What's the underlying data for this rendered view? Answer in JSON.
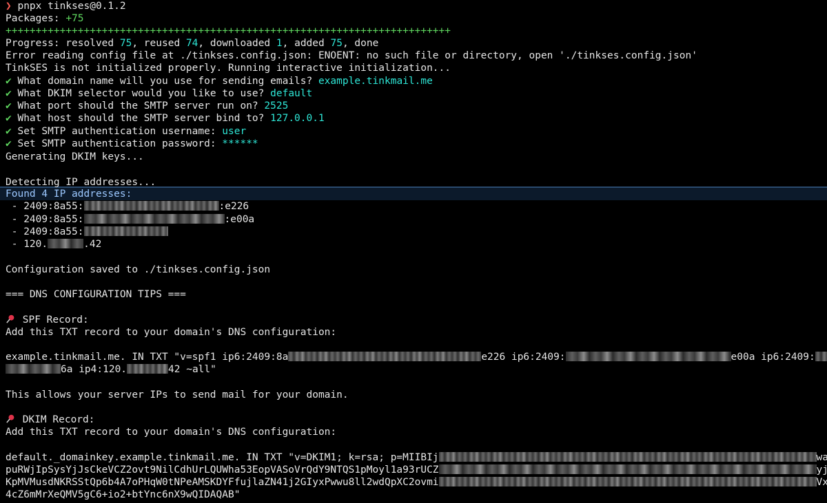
{
  "prompt": {
    "mark": "❯",
    "command": "pnpx tinkses@0.1.2"
  },
  "packages": {
    "label": "Packages: ",
    "value": "+75"
  },
  "progress_bar": "++++++++++++++++++++++++++++++++++++++++++++++++++++++++++++++++++++++++++",
  "progress": {
    "prefix": "Progress: resolved ",
    "resolved": "75",
    "reused_label": ", reused ",
    "reused": "74",
    "downloaded_label": ", downloaded ",
    "downloaded": "1",
    "added_label": ", added ",
    "added": "75",
    "suffix": ", done"
  },
  "error_line": "Error reading config file at ./tinkses.config.json: ENOENT: no such file or directory, open './tinkses.config.json'",
  "init_line": "TinkSES is not initialized properly. Running interactive initialization...",
  "questions": [
    {
      "check": "✔",
      "question": " What domain name will you use for sending emails? ",
      "answer": "example.tinkmail.me"
    },
    {
      "check": "✔",
      "question": " What DKIM selector would you like to use? ",
      "answer": "default"
    },
    {
      "check": "✔",
      "question": " What port should the SMTP server run on? ",
      "answer": "2525"
    },
    {
      "check": "✔",
      "question": " What host should the SMTP server bind to? ",
      "answer": "127.0.0.1"
    },
    {
      "check": "✔",
      "question": " Set SMTP authentication username: ",
      "answer": "user"
    },
    {
      "check": "✔",
      "question": " Set SMTP authentication password: ",
      "answer": "******"
    }
  ],
  "generating": "Generating DKIM keys...",
  "detecting": "Detecting IP addresses...",
  "found": "Found 4 IP addresses:",
  "ips": [
    {
      "prefix": " - 2409:8a55:",
      "suffix": ":e226"
    },
    {
      "prefix": " - 2409:8a55:",
      "suffix": ":e00a"
    },
    {
      "prefix": " - 2409:8a55:",
      "suffix": ""
    },
    {
      "prefix": " - 120.",
      "suffix": ".42"
    }
  ],
  "saved": "Configuration saved to ./tinkses.config.json",
  "dns_header": "=== DNS CONFIGURATION TIPS ===",
  "spf": {
    "title": " SPF Record:",
    "instruction": "Add this TXT record to your domain's DNS configuration:",
    "line1_a": "example.tinkmail.me. IN TXT \"v=spf1 ip6:2409:8a",
    "line1_b": "e226 ip6:2409:",
    "line1_c": "e00a ip6:2409:",
    "line2_a": "6a ip4:120.",
    "line2_b": "42 ~all\"",
    "note": "This allows your server IPs to send mail for your domain."
  },
  "dkim": {
    "title": " DKIM Record:",
    "instruction": "Add this TXT record to your domain's DNS configuration:",
    "line1": "default._domainkey.example.tinkmail.me. IN TXT \"v=DKIM1; k=rsa; p=MIIBIj",
    "line1_end": "wa",
    "line2": "puRWjIpSysYjJsCkeVCZ2ovt9NilCdhUrLQUWha53EopVASoVrQdY9NTQS1pMoyl1a93rUCZ",
    "line2_end": "yj",
    "line3": "KpMVMusdNKRSStQp6b4A7oPHqW0tNPeAMSKDYFfujlaZN41j2GIyxPwwu8ll2wdQpXC2ovmi",
    "line3_end": "Vx",
    "line4": "4cZ6mMrXeQMV5gC6+io2+btYnc6nX9wQIDAQAB\""
  }
}
